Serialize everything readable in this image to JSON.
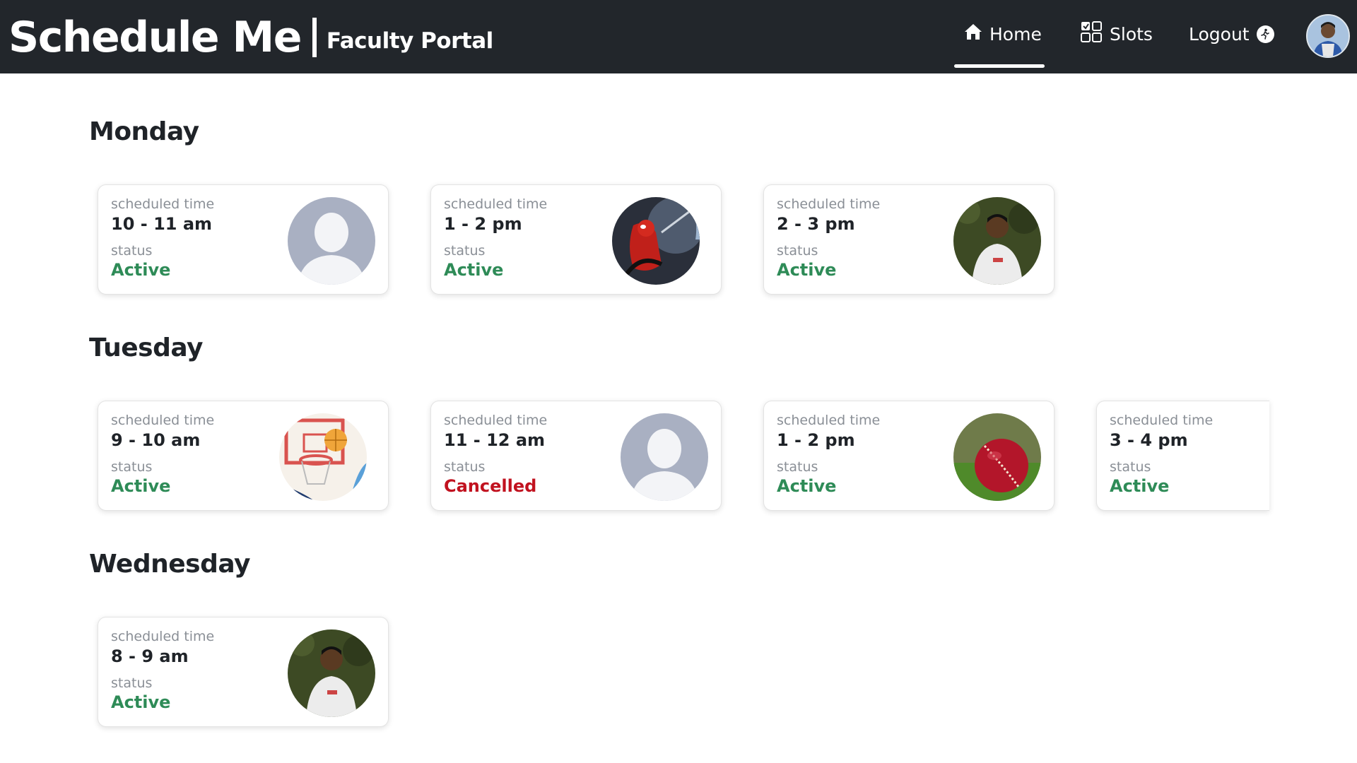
{
  "app": {
    "title": "Schedule Me",
    "subtitle": "Faculty Portal"
  },
  "nav": {
    "home": "Home",
    "slots": "Slots",
    "logout": "Logout",
    "active_tab": "Home",
    "icons": {
      "home": "home-icon",
      "slots": "grid-check-icon",
      "logout": "run-icon",
      "avatar": "user-avatar"
    }
  },
  "labels": {
    "scheduled_time": "scheduled time",
    "status": "status"
  },
  "colors": {
    "topbar": "#22262b",
    "active": "#2e8b57",
    "cancelled": "#c1121f"
  },
  "days": [
    {
      "name": "Monday",
      "slots": [
        {
          "time": "10 - 11 am",
          "status": "Active",
          "image": "default-avatar"
        },
        {
          "time": "1 - 2 pm",
          "status": "Active",
          "image": "superhero-art"
        },
        {
          "time": "2 - 3 pm",
          "status": "Active",
          "image": "student-photo"
        }
      ]
    },
    {
      "name": "Tuesday",
      "slots": [
        {
          "time": "9 - 10 am",
          "status": "Active",
          "image": "basketball-hoop"
        },
        {
          "time": "11 - 12 am",
          "status": "Cancelled",
          "image": "default-avatar"
        },
        {
          "time": "1 - 2 pm",
          "status": "Active",
          "image": "cricket-ball"
        },
        {
          "time": "3 - 4 pm",
          "status": "Active",
          "image": ""
        }
      ]
    },
    {
      "name": "Wednesday",
      "slots": [
        {
          "time": "8 - 9 am",
          "status": "Active",
          "image": "student-photo"
        }
      ]
    }
  ]
}
